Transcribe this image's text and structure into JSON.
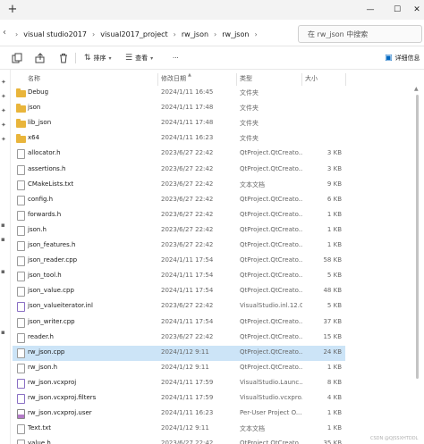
{
  "titlebar": {
    "new_tab_symbol": "+",
    "minimize_symbol": "—",
    "maximize_symbol": "☐",
    "close_symbol": "✕"
  },
  "address": {
    "nav_symbol": "‹",
    "breadcrumbs": [
      "visual studio2017",
      "visual2017_project",
      "rw_json",
      "rw_json"
    ],
    "separator": "›",
    "search_placeholder": "在 rw_json 中搜索"
  },
  "commands": {
    "sort_label": "排序",
    "view_label": "查看",
    "more_label": "···",
    "details_label": "详细信息"
  },
  "columns": {
    "name": "名称",
    "date": "修改日期",
    "type": "类型",
    "size": "大小"
  },
  "files": [
    {
      "name": "Debug",
      "date": "2024/1/11 16:45",
      "type": "文件夹",
      "size": "",
      "kind": "folder"
    },
    {
      "name": "json",
      "date": "2024/1/11 17:48",
      "type": "文件夹",
      "size": "",
      "kind": "folder"
    },
    {
      "name": "lib_json",
      "date": "2024/1/11 17:48",
      "type": "文件夹",
      "size": "",
      "kind": "folder"
    },
    {
      "name": "x64",
      "date": "2024/1/11 16:23",
      "type": "文件夹",
      "size": "",
      "kind": "folder"
    },
    {
      "name": "allocator.h",
      "date": "2023/6/27 22:42",
      "type": "QtProject.QtCreato...",
      "size": "3 KB",
      "kind": "file"
    },
    {
      "name": "assertions.h",
      "date": "2023/6/27 22:42",
      "type": "QtProject.QtCreato...",
      "size": "3 KB",
      "kind": "file"
    },
    {
      "name": "CMakeLists.txt",
      "date": "2023/6/27 22:42",
      "type": "文本文档",
      "size": "9 KB",
      "kind": "text"
    },
    {
      "name": "config.h",
      "date": "2023/6/27 22:42",
      "type": "QtProject.QtCreato...",
      "size": "6 KB",
      "kind": "file"
    },
    {
      "name": "forwards.h",
      "date": "2023/6/27 22:42",
      "type": "QtProject.QtCreato...",
      "size": "1 KB",
      "kind": "file"
    },
    {
      "name": "json.h",
      "date": "2023/6/27 22:42",
      "type": "QtProject.QtCreato...",
      "size": "1 KB",
      "kind": "file"
    },
    {
      "name": "json_features.h",
      "date": "2023/6/27 22:42",
      "type": "QtProject.QtCreato...",
      "size": "1 KB",
      "kind": "file"
    },
    {
      "name": "json_reader.cpp",
      "date": "2024/1/11 17:54",
      "type": "QtProject.QtCreato...",
      "size": "58 KB",
      "kind": "file"
    },
    {
      "name": "json_tool.h",
      "date": "2024/1/11 17:54",
      "type": "QtProject.QtCreato...",
      "size": "5 KB",
      "kind": "file"
    },
    {
      "name": "json_value.cpp",
      "date": "2024/1/11 17:54",
      "type": "QtProject.QtCreato...",
      "size": "48 KB",
      "kind": "file"
    },
    {
      "name": "json_valueiterator.inl",
      "date": "2023/6/27 22:42",
      "type": "VisualStudio.inl.12.0",
      "size": "5 KB",
      "kind": "vs"
    },
    {
      "name": "json_writer.cpp",
      "date": "2024/1/11 17:54",
      "type": "QtProject.QtCreato...",
      "size": "37 KB",
      "kind": "file"
    },
    {
      "name": "reader.h",
      "date": "2023/6/27 22:42",
      "type": "QtProject.QtCreato...",
      "size": "15 KB",
      "kind": "file"
    },
    {
      "name": "rw_json.cpp",
      "date": "2024/1/12 9:11",
      "type": "QtProject.QtCreato...",
      "size": "24 KB",
      "kind": "file",
      "selected": true
    },
    {
      "name": "rw_json.h",
      "date": "2024/1/12 9:11",
      "type": "QtProject.QtCreato...",
      "size": "1 KB",
      "kind": "file"
    },
    {
      "name": "rw_json.vcxproj",
      "date": "2024/1/11 17:59",
      "type": "VisualStudio.Launc...",
      "size": "8 KB",
      "kind": "vs"
    },
    {
      "name": "rw_json.vcxproj.filters",
      "date": "2024/1/11 17:59",
      "type": "VisualStudio.vcxpro...",
      "size": "4 KB",
      "kind": "vs"
    },
    {
      "name": "rw_json.vcxproj.user",
      "date": "2024/1/11 16:23",
      "type": "Per-User Project O...",
      "size": "1 KB",
      "kind": "user"
    },
    {
      "name": "Text.txt",
      "date": "2024/1/12 9:11",
      "type": "文本文档",
      "size": "1 KB",
      "kind": "text"
    },
    {
      "name": "value.h",
      "date": "2023/6/27 22:42",
      "type": "QtProject.QtCreato...",
      "size": "35 KB",
      "kind": "file"
    }
  ],
  "watermark": "CSDN @QJSSXHTDDL"
}
